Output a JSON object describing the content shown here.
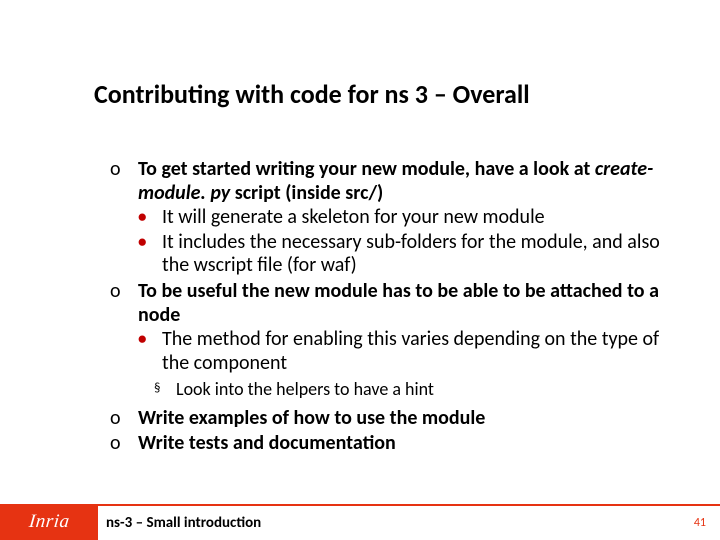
{
  "title": "Contributing with code for ns 3 – Overall",
  "bullets": {
    "o1_lead": "To get started writing your new module, have a look at ",
    "o1_em": "create-module. py",
    "o1_tail": " script (inside src/)",
    "o1_d1": "It will generate a skeleton for your new module",
    "o1_d2": "It includes the necessary sub-folders for the module, and also the wscript file (for waf)",
    "o2": "To be useful the new module has to be able to be attached to a node",
    "o2_d1": "The method for enabling this varies depending on the type of the component",
    "o2_sq1": "Look into the helpers to have a hint",
    "o3": "Write examples of how to use the module",
    "o4": "Write tests and documentation"
  },
  "markers": {
    "o": "o",
    "dot": "•",
    "sq": "§"
  },
  "footer": {
    "logo": "Inria",
    "text": "ns-3 – Small introduction",
    "page": "41"
  },
  "colors": {
    "accent": "#e63312"
  }
}
